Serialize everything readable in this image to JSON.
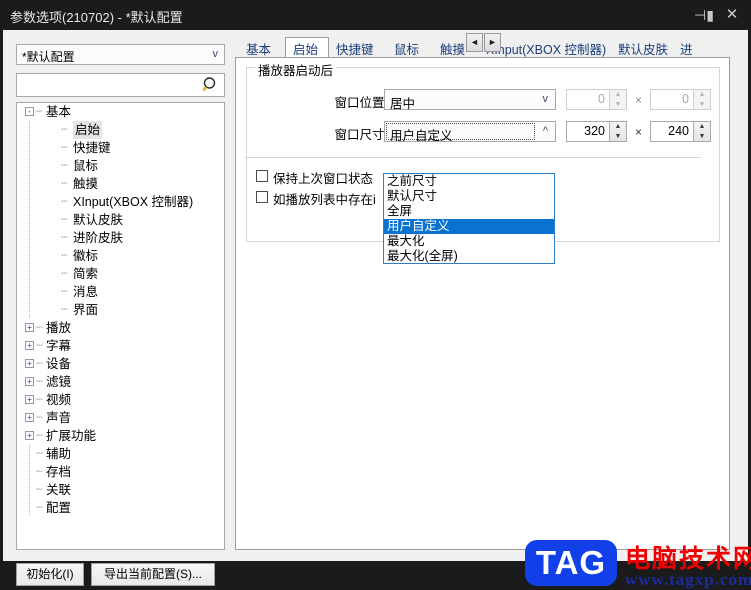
{
  "window": {
    "title": "参数选项(210702) - *默认配置",
    "pin_icon": "pin-icon",
    "close_icon": "close-icon"
  },
  "sidebar": {
    "config_combo": {
      "value": "*默认配置",
      "chevron": "v"
    },
    "search": {
      "value": "",
      "placeholder": "",
      "icon": "search-icon"
    },
    "tree": [
      {
        "label": "基本",
        "level": 0,
        "expander": "-",
        "selected": false
      },
      {
        "label": "启始",
        "level": 1,
        "expander": "",
        "selected": true
      },
      {
        "label": "快捷键",
        "level": 1,
        "expander": "",
        "selected": false
      },
      {
        "label": "鼠标",
        "level": 1,
        "expander": "",
        "selected": false
      },
      {
        "label": "触摸",
        "level": 1,
        "expander": "",
        "selected": false
      },
      {
        "label": "XInput(XBOX 控制器)",
        "level": 1,
        "expander": "",
        "selected": false
      },
      {
        "label": "默认皮肤",
        "level": 1,
        "expander": "",
        "selected": false
      },
      {
        "label": "进阶皮肤",
        "level": 1,
        "expander": "",
        "selected": false
      },
      {
        "label": "徽标",
        "level": 1,
        "expander": "",
        "selected": false
      },
      {
        "label": "简索",
        "level": 1,
        "expander": "",
        "selected": false
      },
      {
        "label": "消息",
        "level": 1,
        "expander": "",
        "selected": false
      },
      {
        "label": "界面",
        "level": 1,
        "expander": "",
        "selected": false
      },
      {
        "label": "播放",
        "level": 0,
        "expander": "+",
        "selected": false
      },
      {
        "label": "字幕",
        "level": 0,
        "expander": "+",
        "selected": false
      },
      {
        "label": "设备",
        "level": 0,
        "expander": "+",
        "selected": false
      },
      {
        "label": "滤镜",
        "level": 0,
        "expander": "+",
        "selected": false
      },
      {
        "label": "视频",
        "level": 0,
        "expander": "+",
        "selected": false
      },
      {
        "label": "声音",
        "level": 0,
        "expander": "+",
        "selected": false
      },
      {
        "label": "扩展功能",
        "level": 0,
        "expander": "+",
        "selected": false
      },
      {
        "label": "辅助",
        "level": 0,
        "expander": "",
        "selected": false
      },
      {
        "label": "存档",
        "level": 0,
        "expander": "",
        "selected": false
      },
      {
        "label": "关联",
        "level": 0,
        "expander": "",
        "selected": false
      },
      {
        "label": "配置",
        "level": 0,
        "expander": "",
        "selected": false
      }
    ],
    "buttons": {
      "init": "初始化(I)",
      "export": "导出当前配置(S)..."
    }
  },
  "tabs": {
    "items": [
      {
        "label": "基本",
        "active": false
      },
      {
        "label": "启始",
        "active": true
      },
      {
        "label": "快捷键",
        "active": false
      },
      {
        "label": "鼠标",
        "active": false
      },
      {
        "label": "触摸",
        "active": false
      },
      {
        "label": "XInput(XBOX 控制器)",
        "active": false
      },
      {
        "label": "默认皮肤",
        "active": false
      },
      {
        "label": "进",
        "active": false
      }
    ],
    "scroll_left": "◄",
    "scroll_right": "►"
  },
  "main": {
    "group_title": "播放器启动后",
    "window_position": {
      "label": "窗口位置:",
      "value": "居中",
      "chevron": "v",
      "x": "0",
      "y": "0",
      "separator": "×",
      "enabled": false
    },
    "window_size": {
      "label": "窗口尺寸:",
      "value": "用户自定义",
      "chevron": "^",
      "width": "320",
      "height": "240",
      "separator": "×",
      "enabled": true,
      "options": [
        {
          "label": "之前尺寸",
          "selected": false
        },
        {
          "label": "默认尺寸",
          "selected": false
        },
        {
          "label": "全屏",
          "selected": false
        },
        {
          "label": "用户自定义",
          "selected": true
        },
        {
          "label": "最大化",
          "selected": false
        },
        {
          "label": "最大化(全屏)",
          "selected": false
        }
      ]
    },
    "checkboxes": [
      {
        "label": "保持上次窗口状态",
        "checked": false
      },
      {
        "label": "如播放列表中存在i",
        "checked": false
      }
    ],
    "spin_up": "▲",
    "spin_down": "▼"
  },
  "watermark": {
    "logo": "TAG",
    "site_name": "电脑技术网",
    "url": "www.tagxp.com",
    "logo_color": "#1140e8",
    "name_color": "#ee0000",
    "url_color": "#1c2b9e"
  }
}
